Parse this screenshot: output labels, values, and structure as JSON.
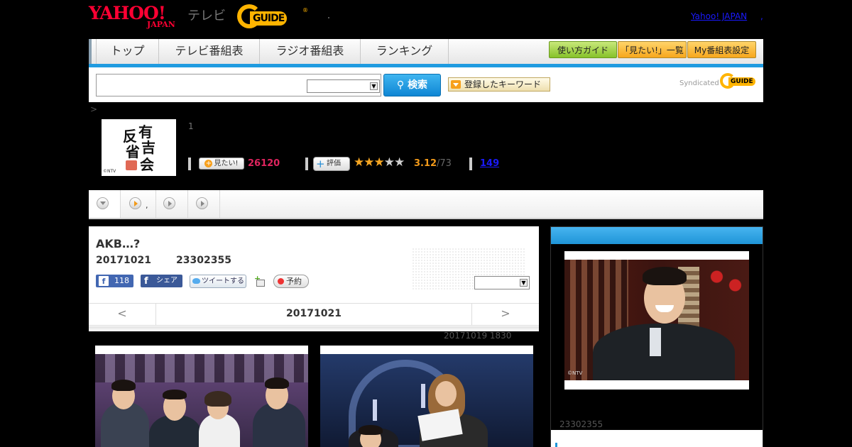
{
  "header": {
    "yahoo_logo": "YAHOO!",
    "yahoo_logo_sub": "JAPAN",
    "tv_label": "テレビ",
    "gguide_logo": "GUIDE",
    "gguide_reg": "®",
    "yj_link": "Yahoo! JAPAN",
    "trailing_dot": ","
  },
  "nav": {
    "tabs": [
      "トップ",
      "テレビ番組表",
      "ラジオ番組表",
      "ランキング"
    ],
    "buttons": [
      "使い方ガイド",
      "「見たい!」一覧",
      "My番組表設定"
    ]
  },
  "search": {
    "button_label": "検索",
    "keyword_button": "登録したキーワード",
    "syndicated": "Syndicated",
    "syndicated_logo": "GUIDE"
  },
  "breadcrumb": ">",
  "program": {
    "image_chars": [
      "有",
      "吉",
      "反",
      "省",
      "会"
    ],
    "image_copyright": "©NTV",
    "number": "1",
    "mitai_label": "見たい!",
    "mitai_count": "26120",
    "hyoka_label": "評価",
    "stars_on": "★★★",
    "stars_off": "★★",
    "rating": "3.12",
    "rating_total": "/73",
    "review_count": "149"
  },
  "tabs": {
    "dot": ","
  },
  "episode": {
    "title": "AKB…?",
    "date": "20171021",
    "time": "23302355",
    "fb_like_count": "118",
    "fb_share": "シェア",
    "tweet": "ツイートする",
    "reserve": "予約",
    "nav_prev": "<",
    "nav_date": "20171021",
    "nav_next": ">",
    "prev_airing": "20171019  1830"
  },
  "right": {
    "photo_copyright": "©NTV",
    "id_text": "23302355"
  },
  "colors": {
    "accent_blue": "#1f95d8",
    "mitai_pink": "#e0245e",
    "rating_orange": "#f29a1a",
    "link_blue": "#1a1aff"
  }
}
